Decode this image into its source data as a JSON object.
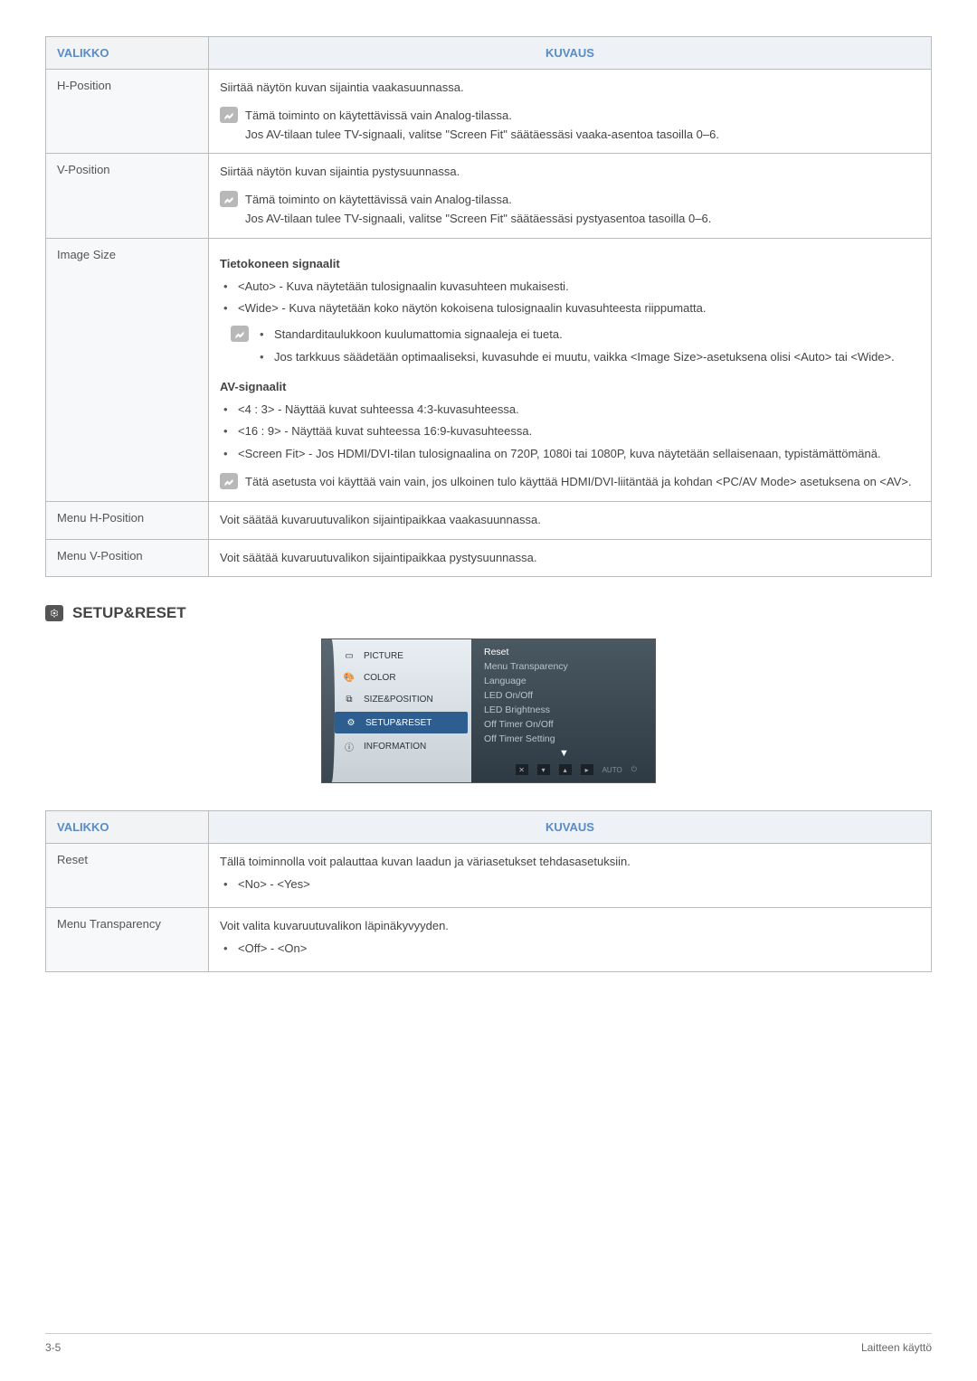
{
  "table1": {
    "header_menu": "VALIKKO",
    "header_desc": "KUVAUS",
    "rows": [
      {
        "menu": "H-Position",
        "desc_line": "Siirtää näytön kuvan sijaintia vaakasuunnassa.",
        "note1": "Tämä toiminto on käytettävissä vain Analog-tilassa.",
        "note2": "Jos AV-tilaan tulee TV-signaali, valitse \"Screen Fit\" säätäessäsi vaaka-asentoa tasoilla 0–6."
      },
      {
        "menu": "V-Position",
        "desc_line": "Siirtää näytön kuvan sijaintia pystysuunnassa.",
        "note1": "Tämä toiminto on käytettävissä vain Analog-tilassa.",
        "note2": "Jos AV-tilaan tulee TV-signaali, valitse \"Screen Fit\" säätäessäsi pystyasentoa tasoilla 0–6."
      },
      {
        "menu": "Image Size",
        "heading1": "Tietokoneen signaalit",
        "b1": "<Auto> - Kuva näytetään tulosignaalin kuvasuhteen mukaisesti.",
        "b2": "<Wide> - Kuva näytetään koko näytön kokoisena tulosignaalin kuvasuhteesta riippumatta.",
        "nb1": "Standarditaulukkoon kuulumattomia signaaleja ei tueta.",
        "nb2": "Jos tarkkuus säädetään optimaaliseksi, kuvasuhde ei muutu, vaikka <Image Size>-asetuksena olisi <Auto> tai <Wide>.",
        "heading2": "AV-signaalit",
        "b3": "<4 : 3> - Näyttää kuvat suhteessa 4:3-kuvasuhteessa.",
        "b4": "<16 : 9> - Näyttää kuvat suhteessa 16:9-kuvasuhteessa.",
        "b5": "<Screen Fit> - Jos HDMI/DVI-tilan tulosignaalina on 720P, 1080i tai 1080P, kuva näytetään sellaisenaan, typistämättömänä.",
        "note_end": "Tätä asetusta voi käyttää vain vain, jos ulkoinen tulo käyttää HDMI/DVI-liitäntää ja kohdan <PC/AV Mode> asetuksena on <AV>."
      },
      {
        "menu": "Menu H-Position",
        "desc_line": "Voit säätää kuvaruutuvalikon sijaintipaikkaa vaakasuunnassa."
      },
      {
        "menu": "Menu V-Position",
        "desc_line": "Voit säätää kuvaruutuvalikon sijaintipaikkaa pystysuunnassa."
      }
    ]
  },
  "section": {
    "title": "SETUP&RESET"
  },
  "osd": {
    "left": [
      "PICTURE",
      "COLOR",
      "SIZE&POSITION",
      "SETUP&RESET",
      "INFORMATION"
    ],
    "right": [
      "Reset",
      "Menu Transparency",
      "Language",
      "LED On/Off",
      "LED Brightness",
      "Off Timer On/Off",
      "Off Timer Setting"
    ],
    "auto": "AUTO"
  },
  "table2": {
    "header_menu": "VALIKKO",
    "header_desc": "KUVAUS",
    "rows": [
      {
        "menu": "Reset",
        "desc": "Tällä toiminnolla voit palauttaa kuvan laadun ja väriasetukset tehdasasetuksiin.",
        "opt": "<No> - <Yes>"
      },
      {
        "menu": "Menu Transparency",
        "desc": "Voit valita kuvaruutuvalikon läpinäkyvyyden.",
        "opt": "<Off> - <On>"
      }
    ]
  },
  "footer": {
    "left": "3-5",
    "right": "Laitteen käyttö"
  }
}
